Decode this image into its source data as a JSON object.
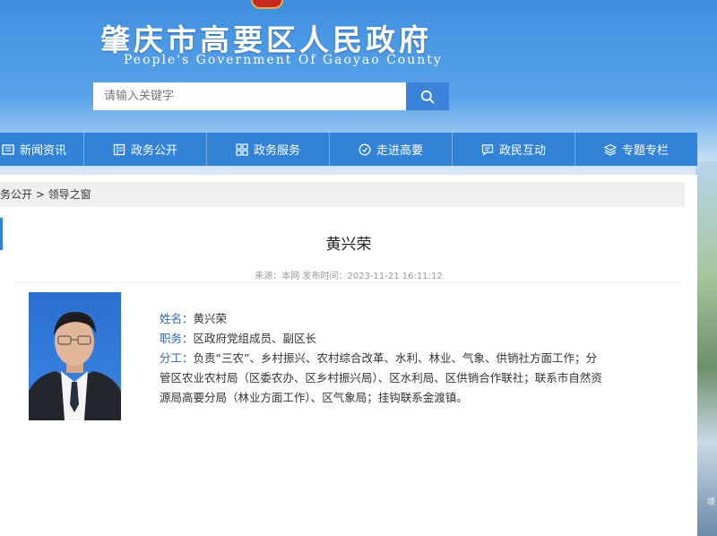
{
  "header": {
    "title": "肇庆市高要区人民政府",
    "subtitle": "People's Government Of Gaoyao County"
  },
  "search": {
    "placeholder": "请输入关键字"
  },
  "nav": {
    "items": [
      {
        "label": "新闻资讯",
        "icon": "news-icon"
      },
      {
        "label": "政务公开",
        "icon": "document-icon"
      },
      {
        "label": "政务服务",
        "icon": "grid-icon"
      },
      {
        "label": "走进高要",
        "icon": "compass-icon"
      },
      {
        "label": "政民互动",
        "icon": "chat-icon"
      },
      {
        "label": "专题专栏",
        "icon": "layers-icon"
      }
    ]
  },
  "breadcrumb": {
    "text": "务公开 > 领导之窗"
  },
  "article": {
    "title": "黄兴荣",
    "meta": "来源：本网 发布时间：2023-11-21 16:11:12"
  },
  "profile": {
    "name_label": "姓名：",
    "name_value": "黄兴荣",
    "position_label": "职务：",
    "position_value": "区政府党组成员、副区长",
    "duty_label": "分工：",
    "duty_value": "负责“三农”、乡村振兴、农村综合改革、水利、林业、气象、供销社方面工作；分管区农业农村局（区委农办、区乡村振兴局）、区水利局、区供销合作联社；联系市自然资源局高要分局（林业方面工作）、区气象局；挂钩联系金渡镇。"
  },
  "side_caption": "项",
  "colors": {
    "nav_bg": "#3283d7",
    "label": "#3466b3",
    "search_button": "#3b83d8"
  }
}
